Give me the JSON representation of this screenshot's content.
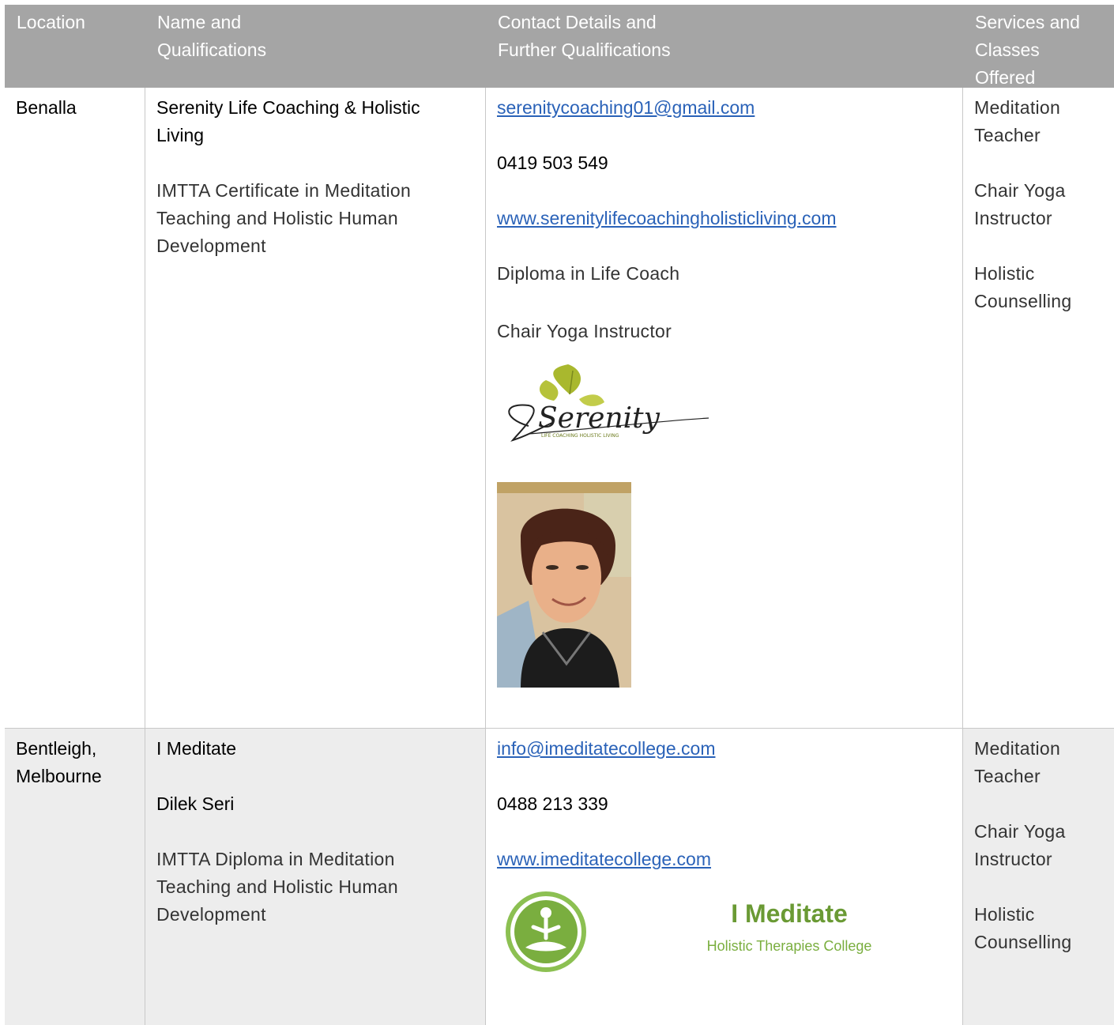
{
  "header": {
    "col1": [
      "Location"
    ],
    "col2": [
      "Name and",
      "Qualifications"
    ],
    "col3": [
      "Contact Details and",
      "Further Qualifications"
    ],
    "col4": [
      "Services and",
      "Classes",
      "Offered"
    ]
  },
  "rows": [
    {
      "location": [
        "Benalla"
      ],
      "name": [
        "Serenity Life Coaching & Holistic",
        "Living"
      ],
      "qualification": [
        "IMTTA Certificate in Meditation",
        "Teaching and Holistic Human",
        "Development"
      ],
      "email": "serenitycoaching01@gmail.com",
      "phone": "0419 503 549",
      "website": "www.serenitylifecoachingholisticliving.com",
      "further": [
        "Diploma in Life Coach",
        "Chair Yoga Instructor"
      ],
      "logo_text": "Serenity",
      "logo_subtext": "LIFE COACHING HOLISTIC LIVING",
      "services": [
        [
          "Meditation",
          "Teacher"
        ],
        [
          "Chair Yoga",
          "Instructor"
        ],
        [
          "Holistic",
          "Counselling"
        ]
      ]
    },
    {
      "location": [
        "Bentleigh,",
        "Melbourne"
      ],
      "name": [
        "I Meditate"
      ],
      "person": "Dilek Seri",
      "qualification": [
        "IMTTA Diploma in Meditation",
        "Teaching and Holistic Human",
        "Development"
      ],
      "email": "info@imeditatecollege.com",
      "phone": "0488 213 339",
      "website": "www.imeditatecollege.com",
      "logo_title": "I Meditate",
      "logo_subtitle": "Holistic Therapies College",
      "services": [
        [
          "Meditation",
          "Teacher"
        ],
        [
          "Chair Yoga",
          "Instructor"
        ],
        [
          "Holistic",
          "Counselling"
        ]
      ]
    }
  ],
  "colors": {
    "header_bg": "#a5a5a5",
    "link": "#2a62b8",
    "row_alt_bg": "#ededed",
    "logo_green": "#7aae3f"
  }
}
